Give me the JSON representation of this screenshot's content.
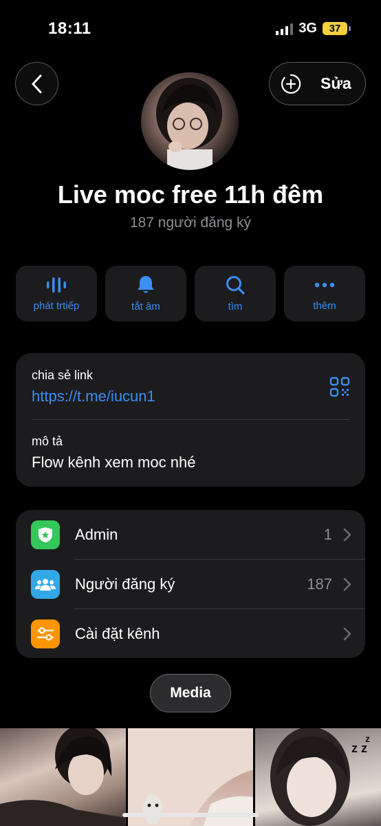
{
  "status_bar": {
    "time": "18:11",
    "network": "3G",
    "battery": "37"
  },
  "header": {
    "edit_label": "Sửa"
  },
  "channel": {
    "title": "Live moc free 11h đêm",
    "subscribers": "187 người đăng ký"
  },
  "actions": [
    {
      "label": "phát trtiếp",
      "icon": "live-stream-icon"
    },
    {
      "label": "tắt âm",
      "icon": "bell-icon"
    },
    {
      "label": "tìm",
      "icon": "search-icon"
    },
    {
      "label": "thêm",
      "icon": "more-icon"
    }
  ],
  "info": {
    "share_label": "chia sẻ link",
    "share_link": "https://t.me/iucun1",
    "description_label": "mô tả",
    "description": "Flow kênh xem moc nhé"
  },
  "settings": [
    {
      "label": "Admin",
      "count": "1",
      "icon": "admin-shield-icon",
      "color": "#34c759"
    },
    {
      "label": "Người đăng ký",
      "count": "187",
      "icon": "people-icon",
      "color": "#32a8e6"
    },
    {
      "label": "Cài đặt kênh",
      "count": "",
      "icon": "sliders-icon",
      "color": "#ff9500"
    }
  ],
  "media_tab": {
    "label": "Media"
  },
  "colors": {
    "accent": "#3b8ef3",
    "background": "#000000",
    "card": "#1c1c1e"
  }
}
